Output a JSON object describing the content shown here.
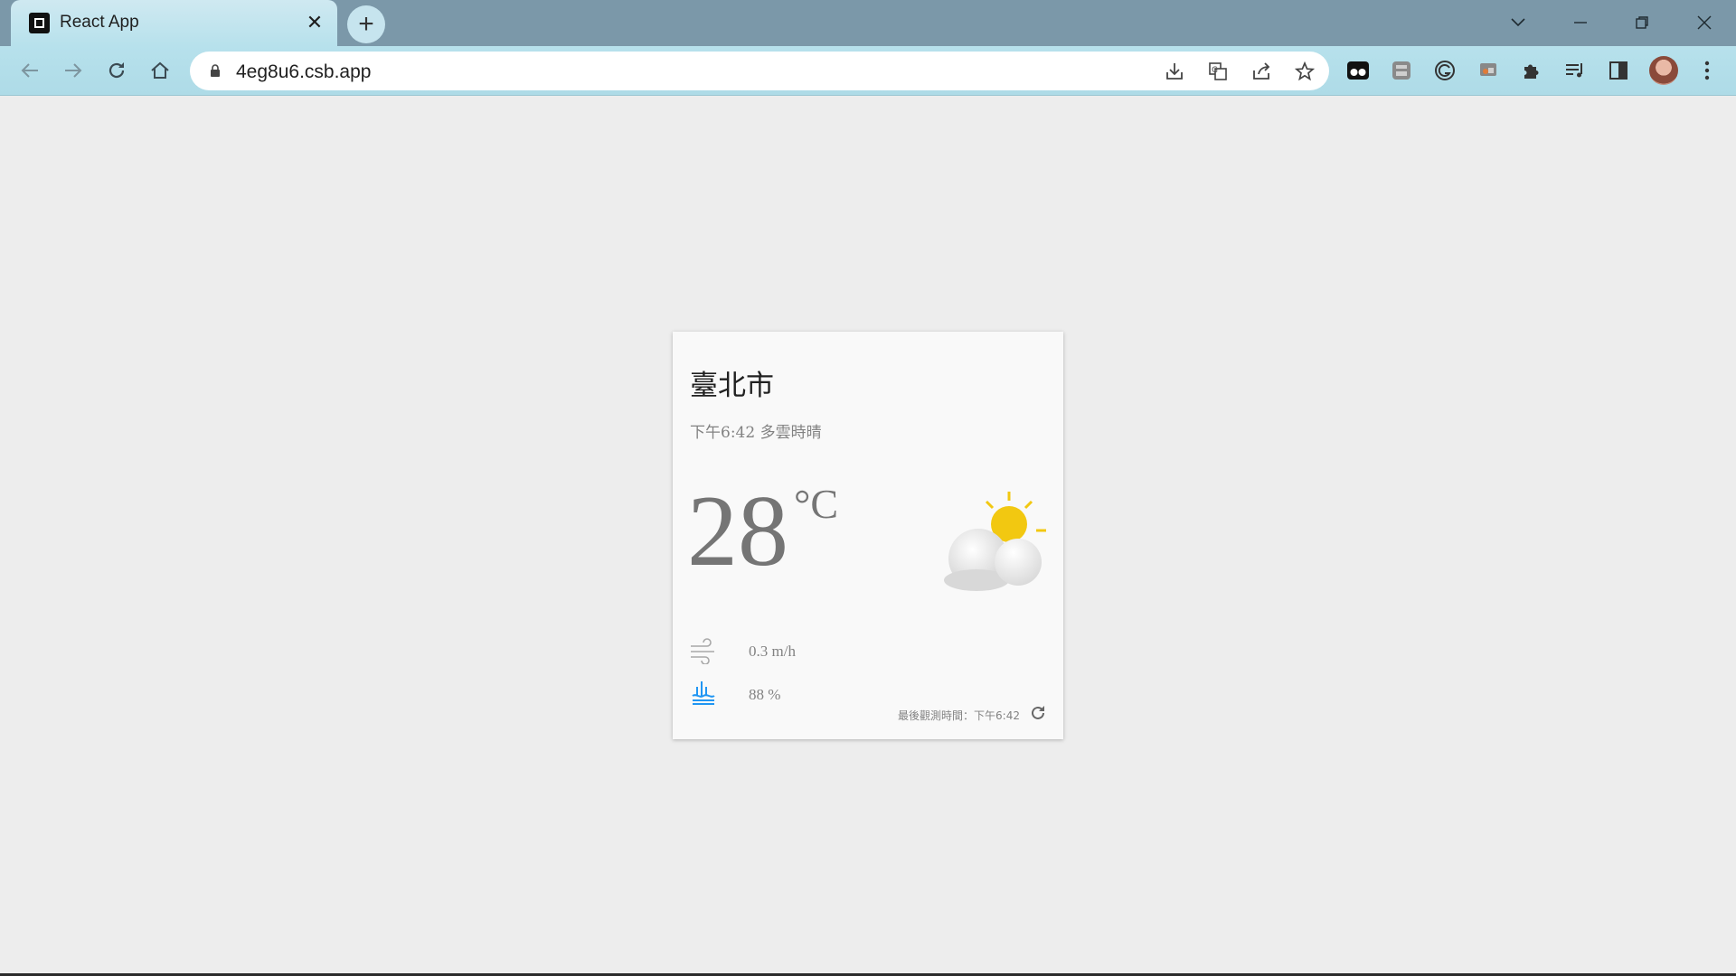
{
  "browser": {
    "tab_title": "React App",
    "url": "4eg8u6.csb.app",
    "icons": {
      "tab_favicon": "codesandbox-icon",
      "tab_close": "close-icon",
      "new_tab": "plus-icon",
      "back": "arrow-left-icon",
      "forward": "arrow-right-icon",
      "reload": "reload-icon",
      "home": "home-icon",
      "lock": "lock-icon",
      "install": "install-icon",
      "translate": "translate-icon",
      "share": "share-icon",
      "bookmark": "star-icon"
    },
    "accent_color": "#b7e1ec",
    "tabstrip_color": "#7b98a9"
  },
  "weather": {
    "location": "臺北市",
    "description": "下午6:42 多雲時晴",
    "temperature": "28",
    "unit": "°C",
    "wind_speed": "0.3 m/h",
    "humidity": "88 %",
    "observation": "最後觀測時間：下午6:42",
    "icons": {
      "condition": "cloudy-sun-icon",
      "wind": "wind-icon",
      "humidity": "rain-icon",
      "refresh": "refresh-icon"
    },
    "colors": {
      "sun": "#f2c811",
      "humidity_icon": "#2196f3",
      "text": "#828282"
    }
  }
}
